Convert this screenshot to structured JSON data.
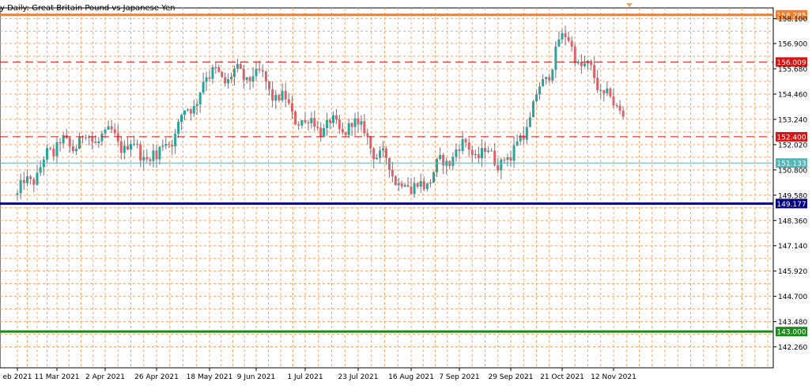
{
  "chart_data": {
    "type": "candlestick",
    "title": "y Daily:  Great Britain Pound vs Japanese Yen",
    "timeframe": "Daily",
    "symbol_description": "Great Britain Pound vs Japanese Yen",
    "x_tick_labels": [
      "eb 2021",
      "11 Mar 2021",
      "2 Apr 2021",
      "26 Apr 2021",
      "18 May 2021",
      "9 Jun 2021",
      "1 Jul 2021",
      "23 Jul 2021",
      "16 Aug 2021",
      "7 Sep 2021",
      "29 Sep 2021",
      "21 Oct 2021",
      "12 Nov 2021"
    ],
    "y_tick_labels": [
      158.1,
      156.9,
      155.68,
      154.46,
      153.24,
      152.02,
      150.8,
      149.58,
      148.36,
      147.14,
      145.92,
      144.7,
      143.48,
      142.26
    ],
    "ylim": [
      141.25,
      158.62
    ],
    "grid": true,
    "colors": {
      "background": "#ffffff",
      "grid": "#f0a878",
      "bull": "#26a69a",
      "bear": "#e0606a",
      "wick": "#7b6e7e",
      "text": "#000000"
    },
    "horizontal_levels": [
      {
        "label": "158.285",
        "value": 158.285,
        "style": "solid",
        "color": "#ff7b24",
        "width": 3
      },
      {
        "label": "156.009",
        "value": 156.009,
        "style": "dashed",
        "color": "#dd1111",
        "width": 1
      },
      {
        "label": "152.400",
        "value": 152.4,
        "style": "dashed",
        "color": "#dd1111",
        "width": 1
      },
      {
        "label": "151.133",
        "value": 151.133,
        "style": "solid",
        "color": "#56b4b4",
        "width": 1
      },
      {
        "label": "149.177",
        "value": 149.177,
        "style": "solid",
        "color": "#000080",
        "width": 3
      },
      {
        "label": "143.000",
        "value": 143.0,
        "style": "solid",
        "color": "#1a8a1a",
        "width": 3
      }
    ],
    "key_closes": [
      [
        "eb 2021",
        149.6
      ],
      [
        "11 Mar 2021",
        151.9
      ],
      [
        "2 Apr 2021",
        152.5
      ],
      [
        "26 Apr 2021",
        151.3
      ],
      [
        "18 May 2021",
        155.3
      ],
      [
        "9 Jun 2021",
        155.4
      ],
      [
        "1 Jul 2021",
        153.0
      ],
      [
        "23 Jul 2021",
        152.8
      ],
      [
        "16 Aug 2021",
        149.6
      ],
      [
        "7 Sep 2021",
        151.9
      ],
      [
        "29 Sep 2021",
        151.2
      ],
      [
        "21 Oct 2021",
        157.2
      ],
      [
        "12 Nov 2021",
        154.0
      ]
    ],
    "last_price": 151.133
  }
}
